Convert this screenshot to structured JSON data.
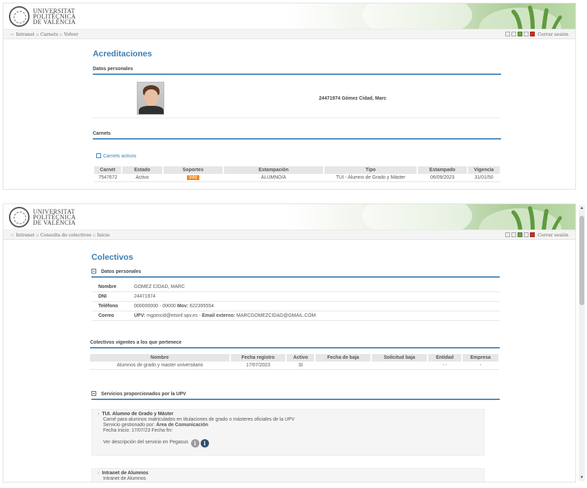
{
  "logo": {
    "line1": "UNIVERSITAT",
    "line2": "POLITÈCNICA",
    "line3": "DE VALÈNCIA"
  },
  "top_panel": {
    "breadcrumb": "Intranet :: Carnets :: Volver",
    "logout": "Cerrar sesión",
    "title": "Acreditaciones",
    "personal_section": "Datos personales",
    "person_line": "24471974 Gómez Cidad, Marc",
    "carnets_section": "Carnets",
    "active_link": "Carnets activos",
    "table": {
      "headers": [
        "Carnet",
        "Estado",
        "Soportes",
        "Estampación",
        "Tipo",
        "Estampado",
        "Vigencia"
      ],
      "row": {
        "carnet": "7547672",
        "estado": "Activo",
        "soportes": "Info",
        "estampacion": "ALUMNO/A",
        "tipo": "TUI - Alumno de Grado y Máster",
        "estampado": "06/09/2023",
        "vigencia": "31/01/50"
      }
    }
  },
  "bottom_panel": {
    "breadcrumb": "Intranet :: Consulta de colectivos :: Inicio",
    "logout": "Cerrar sesión",
    "title": "Colectivos",
    "personal_section": "Datos personales",
    "personal": {
      "nombre_label": "Nombre",
      "nombre": "GOMEZ CIDAD, MARC",
      "dni_label": "DNI",
      "dni": "24471974",
      "telefono_label": "Teléfono",
      "telefono": "000000000 - 00000",
      "mov_label": "Mov:",
      "mov": "622395554",
      "correo_label": "Correo",
      "upv_label": "UPV:",
      "upv_email": "mgomcid@etsinf.upv.es",
      "ext_label": "Email externo:",
      "ext_email": "MARCGOMEZCIDAD@GMAIL.COM"
    },
    "groups_section": "Colectivos vigentes a los que pertenece",
    "groups_table": {
      "headers": [
        "Nombre",
        "Fecha registro",
        "Activo",
        "Fecha de baja",
        "Solicitud baja",
        "Entidad",
        "Empresa"
      ],
      "row": {
        "nombre": "Alumnos de grado y master universitario",
        "fecha_registro": "17/07/2023",
        "activo": "SI",
        "fecha_baja": "",
        "solicitud_baja": "",
        "entidad": "- -",
        "empresa": "-"
      }
    },
    "services_section": "Servicios proporcionados por la UPV",
    "service1": {
      "title": "TUI. Alumno de Grado y Máster",
      "desc": "Carné para alumnos matriculados en titulaciones de grado o másteres oficiales de la UPV",
      "managed_label": "Servicio gestionado por:",
      "managed_by": "Área de Comunicación",
      "dates": "Fecha inicio: 17/07/23 Fecha fin:",
      "pegasus": "Ver descripción del servicio en Pegasus"
    },
    "service2": {
      "title": "Intranet de Alumnos",
      "desc": "Intranet de Alumnos"
    }
  },
  "colors": {
    "accent": "#3d7fb4",
    "info_badge": "#f08a1c",
    "green": "#a9cc95"
  }
}
